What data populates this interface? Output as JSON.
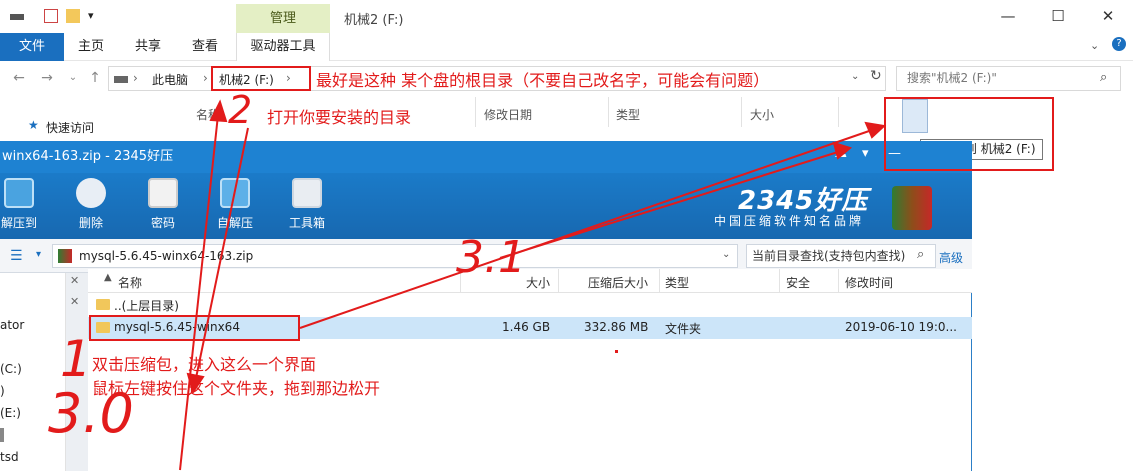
{
  "explorer": {
    "manage_tab": "管理",
    "window_title": "机械2 (F:)",
    "ribbon_tabs": [
      "文件",
      "主页",
      "共享",
      "查看",
      "驱动器工具"
    ],
    "breadcrumb": [
      "此电脑",
      "机械2 (F:)"
    ],
    "search_placeholder": "搜索\"机械2 (F:)\"",
    "columns": [
      "名称",
      "修改日期",
      "类型",
      "大小"
    ],
    "quick_access": "快速访问",
    "copy_tooltip": "复制到 机械2 (F:)",
    "left_nav_fragments": [
      "ator",
      "(C:)",
      ")",
      "(E:)",
      "tsd"
    ]
  },
  "zip_window": {
    "title": "winx64-163.zip - 2345好压",
    "toolbar": [
      "解压到",
      "删除",
      "密码",
      "自解压",
      "工具箱"
    ],
    "brand": "2345好压",
    "slogan": "中国压缩软件知名品牌",
    "path": "mysql-5.6.45-winx64-163.zip",
    "search_placeholder": "当前目录查找(支持包内查找)",
    "advanced": "高级",
    "columns": [
      "名称",
      "大小",
      "压缩后大小",
      "类型",
      "安全",
      "修改时间"
    ],
    "rows": [
      {
        "name": "..(上层目录)",
        "size": "",
        "packed": "",
        "type": "",
        "security": "",
        "modified": ""
      },
      {
        "name": "mysql-5.6.45-winx64",
        "size": "1.46 GB",
        "packed": "332.86 MB",
        "type": "文件夹",
        "security": "",
        "modified": "2019-06-10 19:0..."
      }
    ]
  },
  "annotations": {
    "step2_label": "2",
    "step2_text": "打开你要安装的目录",
    "drive_note": "最好是这种 某个盘的根目录（不要自己改名字，可能会有问题）",
    "step1_label": "1",
    "step30_label": "3.0",
    "step31_label": "3.1",
    "instructions_line1": "双击压缩包，进入这么一个界面",
    "instructions_line2": "鼠标左键按住这个文件夹，拖到那边松开"
  },
  "colors": {
    "annotation": "#e21b1b",
    "zip_blue": "#1e82d2",
    "selected_row": "#cce5f9",
    "manage_tab": "#e4efc5"
  }
}
